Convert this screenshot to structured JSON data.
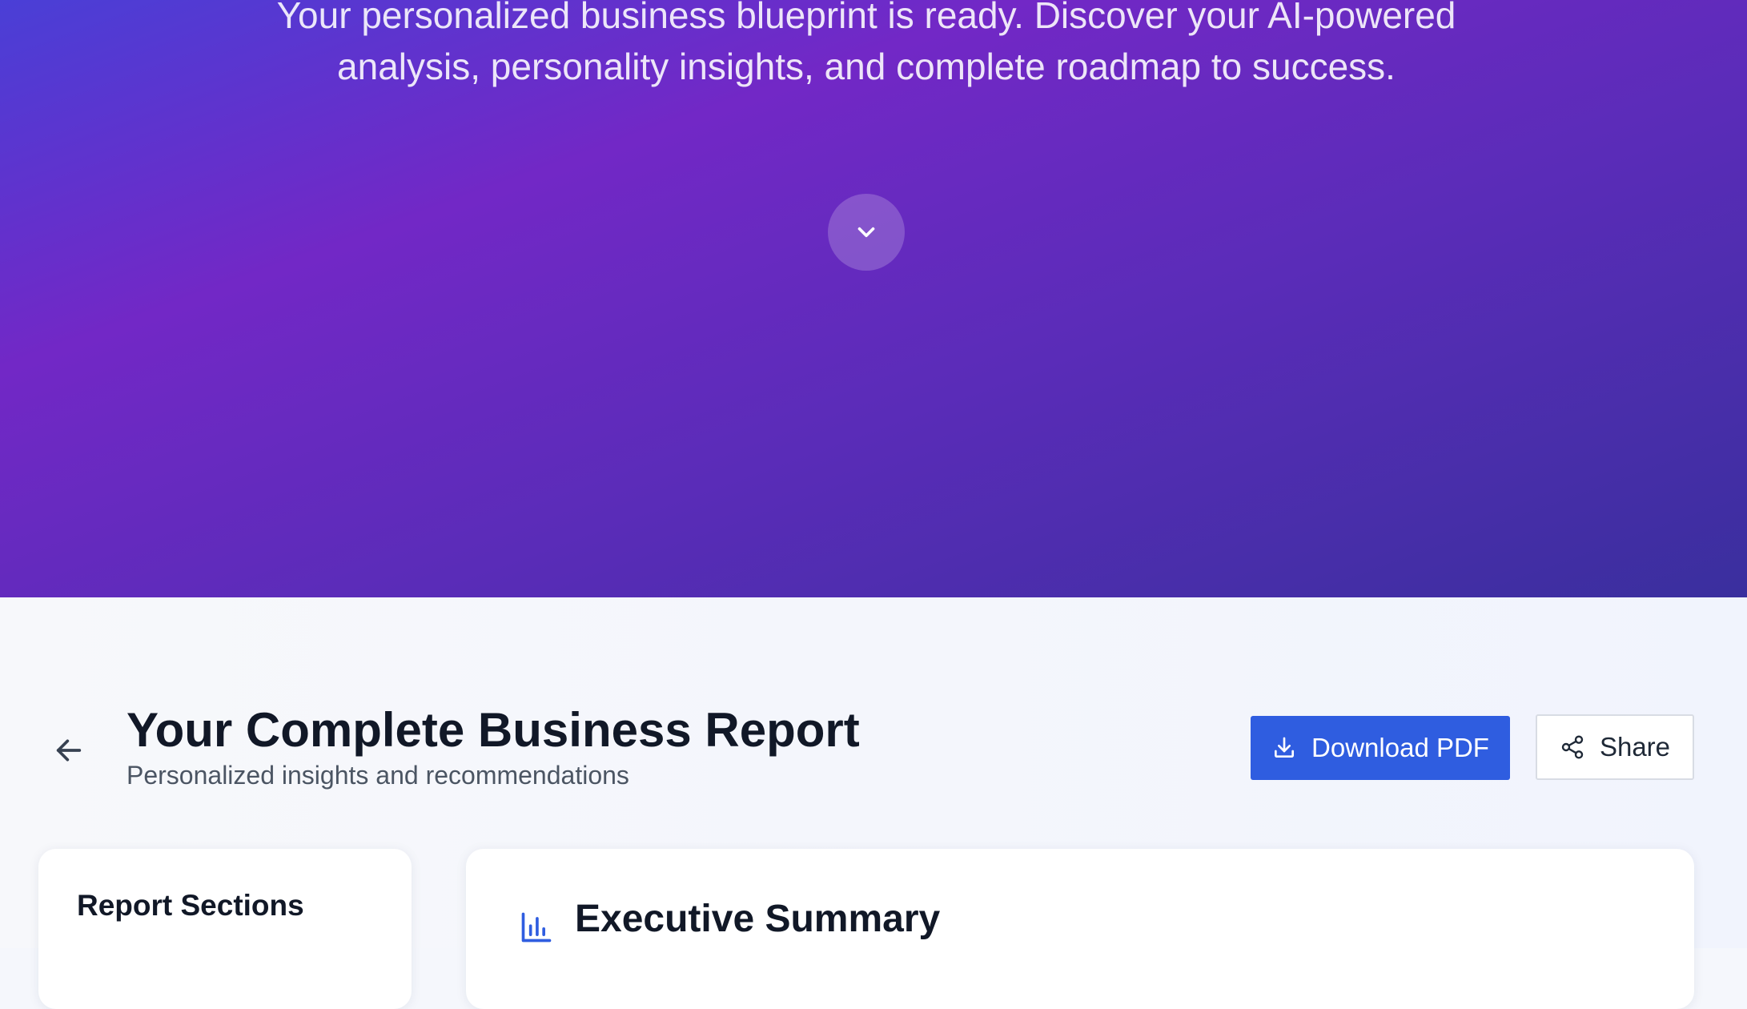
{
  "hero": {
    "line1": "Your personalized business blueprint is ready. Discover your AI-powered",
    "line2": "analysis, personality insights, and complete roadmap to success."
  },
  "header": {
    "title": "Your Complete Business Report",
    "subtitle": "Personalized insights and recommendations",
    "download_label": "Download PDF",
    "share_label": "Share"
  },
  "sidebar": {
    "title": "Report Sections"
  },
  "main": {
    "section_title": "Executive Summary"
  },
  "colors": {
    "accent": "#2f5de0",
    "hero_gradient": [
      "#4a3fd6",
      "#7228c6",
      "#3a2f9e"
    ],
    "title_text": "#111827"
  },
  "icons": [
    "chevron-down-icon",
    "arrow-left-icon",
    "download-icon",
    "share-icon",
    "bar-chart-icon"
  ]
}
